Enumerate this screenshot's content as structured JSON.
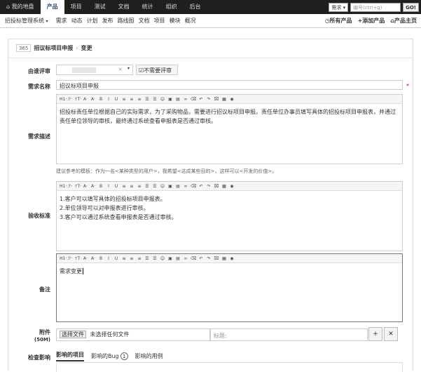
{
  "topnav": {
    "tabs": [
      "⌂ 我的地盘",
      "产品",
      "项目",
      "测试",
      "文档",
      "统计",
      "组织",
      "后台"
    ],
    "active_index": 1,
    "search_type": "需求 ▾",
    "search_placeholder": "编号(ctrl+g)",
    "go_label": "GO!"
  },
  "subnav": {
    "product": "招投标管理系统",
    "items": [
      "需求",
      "动态",
      "计划",
      "发布",
      "路线图",
      "文档",
      "项目",
      "模块",
      "概况"
    ],
    "right": [
      "◷所有产品",
      "+添加产品",
      "⌂产品主页"
    ]
  },
  "breadcrumb": {
    "id": "365",
    "title": "招议标项目申报",
    "sep": "›",
    "action": "变更"
  },
  "form": {
    "reviewer_label": "由谁评审",
    "no_review_label": "不需要评审",
    "name_label": "需求名称",
    "name_value": "招议标项目申报",
    "required_mark": "*",
    "desc_label": "需求描述",
    "desc_content": "招投标责任单位根据自己的实际需求，为了采购物品，需要进行招议标项目申报。责任单位办事员填写具体的招投标项目申报表，并通过责任单位领导的审核，最终通过系统查看申报表是否通过审核。",
    "hint": "建议参考的模板：作为一名<某种类型的用户>，我希望<达成某些目的>，这样可以<开发的价值>。",
    "verify_label": "验收标准",
    "verify_lines": [
      "1.客户可以填写具体的招投标项目申报表。",
      "2.单位领导可以对申报表进行审核。",
      "3.客户可以通过系统查看申报表是否通过审核。"
    ],
    "note_label": "备注",
    "note_content": "需求变更",
    "attach_label": "附件",
    "attach_size": "(50M)",
    "choose_file": "选择文件",
    "no_file": "未选择任何文件",
    "title_placeholder": "标题:",
    "add": "+",
    "remove": "✕",
    "impact_label": "检查影响",
    "impact_tabs": [
      "影响的项目",
      "影响的Bug",
      "影响的用例"
    ],
    "bug_count": "1"
  },
  "toolbar": [
    "H1·",
    "ℱ·",
    "тT·",
    "A·",
    "A·",
    "B",
    "I",
    "U",
    "≡",
    "≡",
    "≡",
    "☰",
    "☰",
    "☺",
    "▣",
    "▤",
    "∞",
    "⌫",
    "↶",
    "↷",
    "⌧",
    "▦",
    "◉"
  ]
}
